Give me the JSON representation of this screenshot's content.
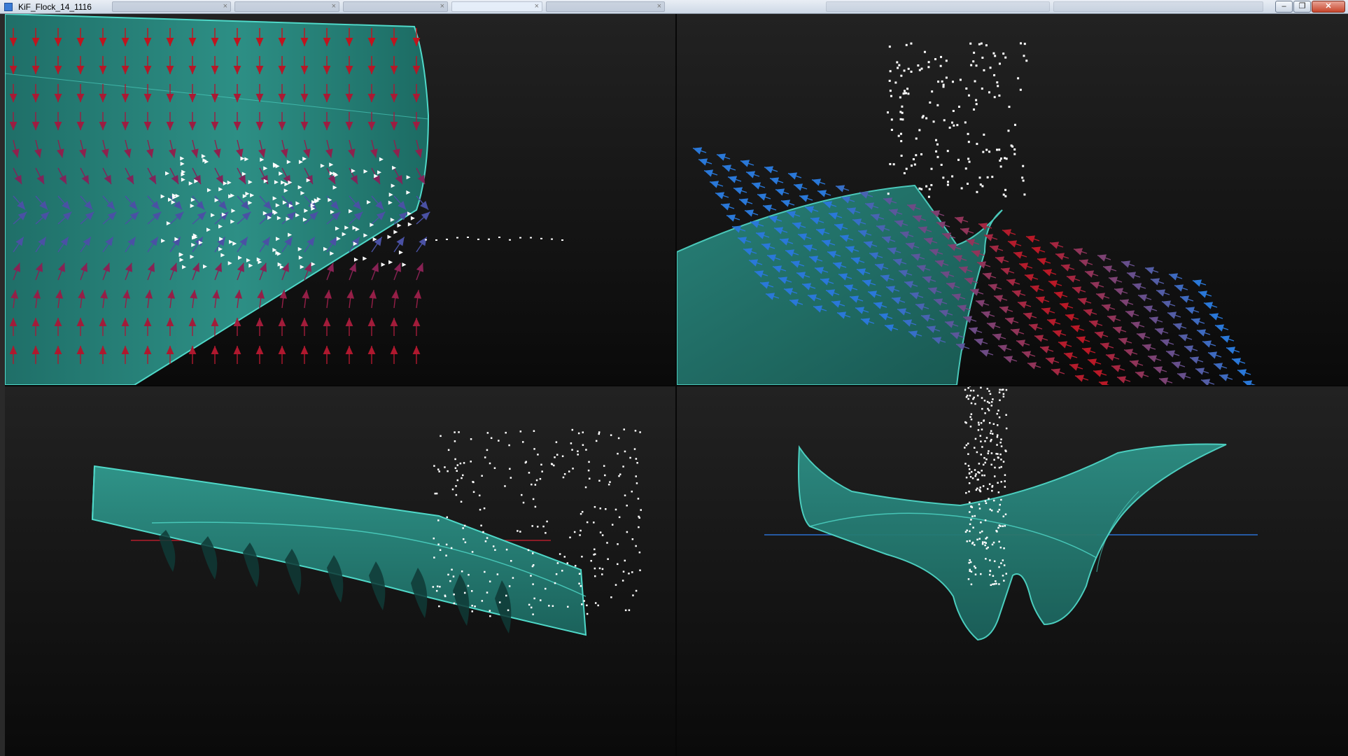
{
  "window": {
    "title": "KiF_Flock_14_1116"
  },
  "taskbar_tabs": [
    {
      "label": "",
      "active": false
    },
    {
      "label": "",
      "active": false
    },
    {
      "label": "",
      "active": false
    },
    {
      "label": "",
      "active": true
    },
    {
      "label": "",
      "active": false
    }
  ],
  "window_controls": {
    "minimize": "–",
    "restore": "❐",
    "close": "✕"
  },
  "colors": {
    "surface": "#2a8a80",
    "surface_edge": "#4fd8c8",
    "arrow_red": "#c0141e",
    "arrow_purple": "#6a2a70",
    "arrow_blue": "#2a78d8",
    "particle": "#ffffff",
    "axis_red": "#b21e2a",
    "axis_blue": "#2a6fd0",
    "background": "#0e0e0e"
  },
  "viewports": [
    {
      "id": "top-left",
      "content": "vector-field-surface-closeup"
    },
    {
      "id": "top-right",
      "content": "vector-field-perspective"
    },
    {
      "id": "bottom-left",
      "content": "ribbon-surface-side"
    },
    {
      "id": "bottom-right",
      "content": "manta-surface-front"
    }
  ]
}
